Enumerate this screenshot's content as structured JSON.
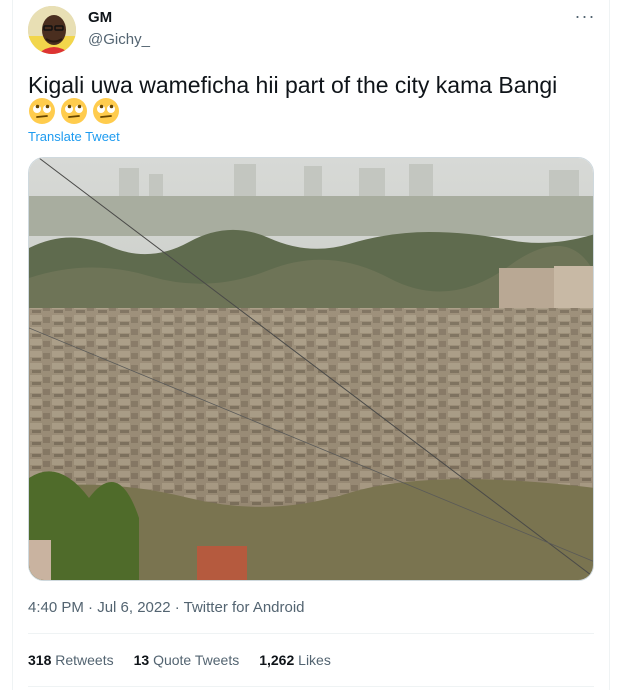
{
  "user": {
    "display_name": "GM",
    "handle": "@Gichy_"
  },
  "more_icon": "more-horizontal-icon",
  "tweet": {
    "text": "Kigali uwa wameficha hii part of the city kama Bangi",
    "emojis": [
      "face-with-rolling-eyes",
      "face-with-rolling-eyes",
      "face-with-rolling-eyes"
    ],
    "translate_label": "Translate Tweet"
  },
  "media": {
    "type": "photo"
  },
  "meta": {
    "timestamp": "4:40 PM · Jul 6, 2022 · Twitter for Android"
  },
  "stats": {
    "retweets_count": "318",
    "retweets_label": "Retweets",
    "quotes_count": "13",
    "quotes_label": "Quote Tweets",
    "likes_count": "1,262",
    "likes_label": "Likes"
  },
  "colors": {
    "link": "#1d9bf0",
    "secondary_text": "#536471",
    "divider": "#eff3f4"
  }
}
